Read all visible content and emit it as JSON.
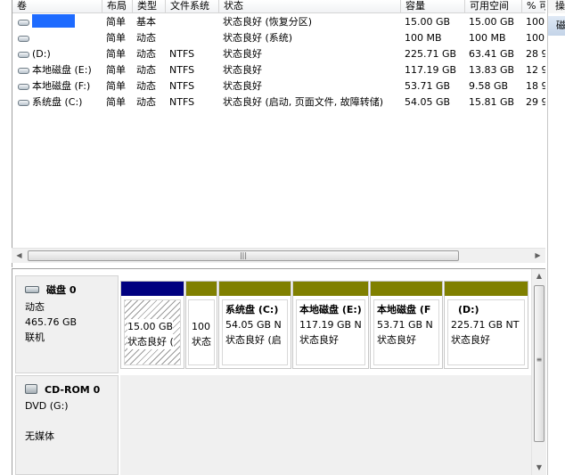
{
  "volume_list": {
    "columns": [
      "卷",
      "布局",
      "类型",
      "文件系统",
      "状态",
      "容量",
      "可用空间",
      "% 可"
    ],
    "rows": [
      {
        "volume": "",
        "layout": "简单",
        "type": "基本",
        "fs": "",
        "status": "状态良好 (恢复分区)",
        "capacity": "15.00 GB",
        "free": "15.00 GB",
        "pct": "100"
      },
      {
        "volume": "",
        "layout": "简单",
        "type": "动态",
        "fs": "",
        "status": "状态良好 (系统)",
        "capacity": "100 MB",
        "free": "100 MB",
        "pct": "100"
      },
      {
        "volume": "(D:)",
        "layout": "简单",
        "type": "动态",
        "fs": "NTFS",
        "status": "状态良好",
        "capacity": "225.71 GB",
        "free": "63.41 GB",
        "pct": "28 9"
      },
      {
        "volume": "本地磁盘 (E:)",
        "layout": "简单",
        "type": "动态",
        "fs": "NTFS",
        "status": "状态良好",
        "capacity": "117.19 GB",
        "free": "13.83 GB",
        "pct": "12 9"
      },
      {
        "volume": "本地磁盘 (F:)",
        "layout": "简单",
        "type": "动态",
        "fs": "NTFS",
        "status": "状态良好",
        "capacity": "53.71 GB",
        "free": "9.58 GB",
        "pct": "18 9"
      },
      {
        "volume": "系统盘 (C:)",
        "layout": "简单",
        "type": "动态",
        "fs": "NTFS",
        "status": "状态良好 (启动, 页面文件, 故障转储)",
        "capacity": "54.05 GB",
        "free": "15.81 GB",
        "pct": "29 9"
      }
    ]
  },
  "action_pane": {
    "header": "操",
    "item": "磁"
  },
  "disk0": {
    "title": "磁盘 0",
    "type": "动态",
    "size": "465.76 GB",
    "state": "联机",
    "partitions": [
      {
        "title": "",
        "size": "15.00 GB",
        "status": "状态良好 (",
        "bar_color": "#000080",
        "hatched": true
      },
      {
        "title": "",
        "size": "100",
        "status": "状态",
        "bar_color": "#808000",
        "hatched": false
      },
      {
        "title": "系统盘  (C:)",
        "size": "54.05 GB N",
        "status": "状态良好 (启",
        "bar_color": "#808000",
        "hatched": false
      },
      {
        "title": "本地磁盘  (E:)",
        "size": "117.19 GB N",
        "status": "状态良好",
        "bar_color": "#808000",
        "hatched": false
      },
      {
        "title": "本地磁盘  (F",
        "size": "53.71 GB N",
        "status": "状态良好",
        "bar_color": "#808000",
        "hatched": false
      },
      {
        "title": "(D:)",
        "size": "225.71 GB NT",
        "status": "状态良好",
        "bar_color": "#808000",
        "hatched": false
      }
    ]
  },
  "cdrom0": {
    "title": "CD-ROM 0",
    "drive": "DVD (G:)",
    "media": "无媒体"
  },
  "scrollbar": {
    "left_arrow": "◀",
    "right_arrow": "▶",
    "up_arrow": "▲",
    "down_arrow": "▼",
    "grip": "|||"
  }
}
